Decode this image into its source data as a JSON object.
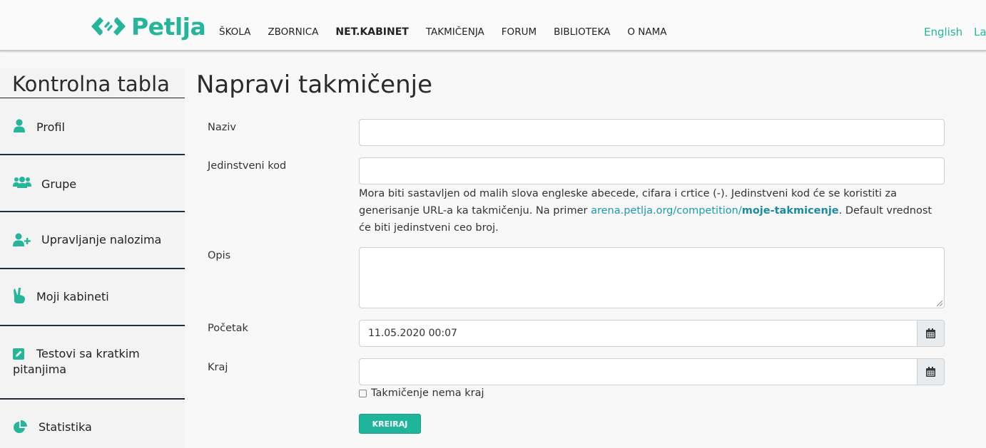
{
  "header": {
    "brand": "Petlja",
    "nav": [
      {
        "label": "ŠKOLA"
      },
      {
        "label": "ZBORNICA"
      },
      {
        "label": "NET.KABINET"
      },
      {
        "label": "TAKMIČENJA"
      },
      {
        "label": "FORUM"
      },
      {
        "label": "BIBLIOTEKA"
      },
      {
        "label": "O NAMA"
      }
    ],
    "lang_english": "English",
    "lang_latin": "Lat"
  },
  "sidebar": {
    "title": "Kontrolna tabla",
    "items": [
      {
        "label": "Profil",
        "icon": "user-icon"
      },
      {
        "label": "Grupe",
        "icon": "users-icon"
      },
      {
        "label": "Upravljanje nalozima",
        "icon": "user-plus-icon"
      },
      {
        "label": "Moji kabineti",
        "icon": "hand-peace-icon"
      },
      {
        "label": "Testovi sa kratkim",
        "label2": "pitanjima",
        "icon": "edit-icon"
      },
      {
        "label": "Statistika",
        "icon": "pie-chart-icon"
      }
    ]
  },
  "main": {
    "title": "Napravi takmičenje",
    "fields": {
      "naziv_label": "Naziv",
      "naziv_value": "",
      "kod_label": "Jedinstveni kod",
      "kod_value": "",
      "kod_help_1": "Mora biti sastavljen od malih slova engleske abecede, cifara i crtice (-). Jedinstveni kod će se koristiti za generisanje URL-a ka takmičenju. Na primer ",
      "kod_help_link": "arena.petlja.org/competition/",
      "kod_help_link_bold": "moje-takmicenje",
      "kod_help_2": ". Default vrednost će biti jedinstveni ceo broj.",
      "opis_label": "Opis",
      "opis_value": "",
      "pocetak_label": "Početak",
      "pocetak_value": "11.05.2020 00:07",
      "kraj_label": "Kraj",
      "kraj_value": "",
      "no_end_label": "Takmičenje nema kraj",
      "no_end_checked": false
    },
    "submit_label": "KREIRAJ"
  },
  "colors": {
    "accent": "#24b59b",
    "link": "#1a9ab5",
    "separator": "#1f2d40"
  }
}
